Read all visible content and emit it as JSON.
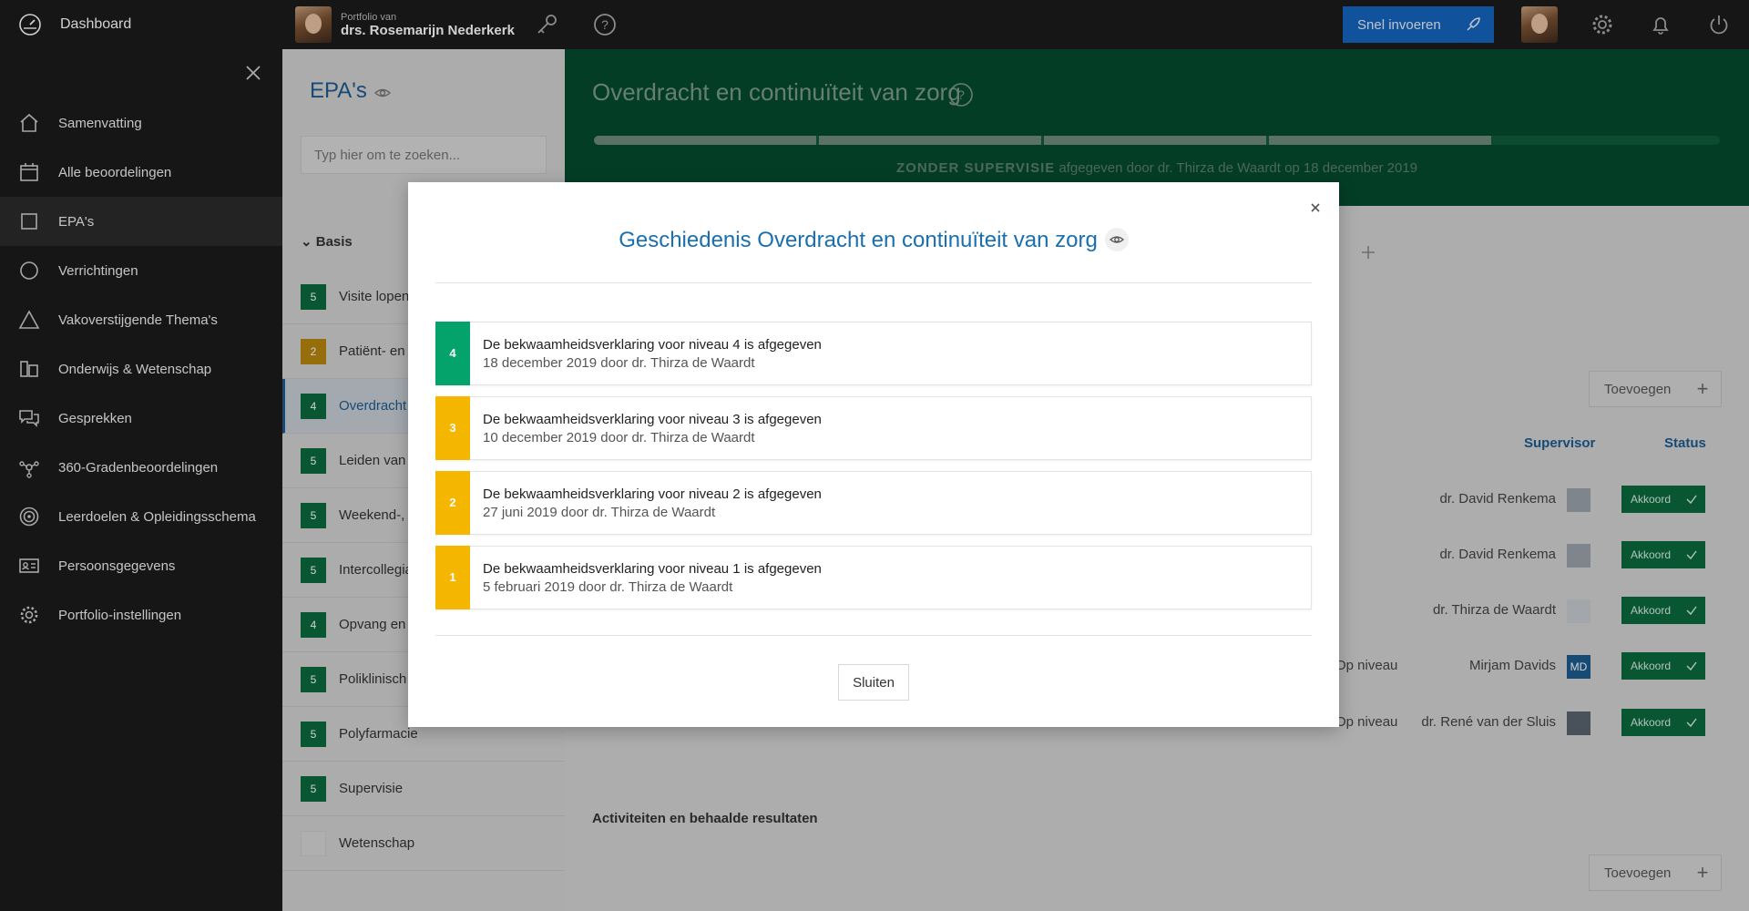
{
  "topbar": {
    "dashboard_label": "Dashboard",
    "portfolio_small": "Portfolio van",
    "portfolio_name": "drs. Rosemarijn Nederkerk",
    "snel_label": "Snel invoeren",
    "accent": "#1565c0"
  },
  "sidebar": {
    "items": [
      {
        "label": "Samenvatting",
        "icon": "home-icon"
      },
      {
        "label": "Alle beoordelingen",
        "icon": "calendar-icon"
      },
      {
        "label": "EPA's",
        "icon": "square-icon"
      },
      {
        "label": "Verrichtingen",
        "icon": "circle-icon"
      },
      {
        "label": "Vakoverstijgende Thema's",
        "icon": "triangle-icon"
      },
      {
        "label": "Onderwijs & Wetenschap",
        "icon": "books-icon"
      },
      {
        "label": "Gesprekken",
        "icon": "chat-icon"
      },
      {
        "label": "360-Gradenbeoordelingen",
        "icon": "network-icon"
      },
      {
        "label": "Leerdoelen & Opleidingsschema",
        "icon": "target-icon"
      },
      {
        "label": "Persoonsgegevens",
        "icon": "id-card-icon"
      },
      {
        "label": "Portfolio-instellingen",
        "icon": "gear-icon"
      }
    ]
  },
  "epa_panel": {
    "title": "EPA's",
    "search_placeholder": "Typ hier om te zoeken...",
    "group": "Basis",
    "items": [
      {
        "badge": "5",
        "label": "Visite lopen",
        "color": "#0b6a3f"
      },
      {
        "badge": "2",
        "label": "Patiënt- en f",
        "color": "#b8870e"
      },
      {
        "badge": "4",
        "label": "Overdracht",
        "color": "#0b6a3f"
      },
      {
        "badge": "5",
        "label": "Leiden van c",
        "color": "#0b6a3f"
      },
      {
        "badge": "5",
        "label": "Weekend-, a",
        "color": "#0b6a3f"
      },
      {
        "badge": "5",
        "label": "Intercollegia",
        "color": "#0b6a3f"
      },
      {
        "badge": "4",
        "label": "Opvang en b",
        "color": "#0b6a3f"
      },
      {
        "badge": "5",
        "label": "Poliklinisch",
        "color": "#0b6a3f"
      },
      {
        "badge": "5",
        "label": "Polyfarmacie",
        "color": "#0b6a3f"
      },
      {
        "badge": "5",
        "label": "Supervisie",
        "color": "#0b6a3f"
      },
      {
        "badge": "",
        "label": "Wetenschap",
        "color": "#d2d2d2"
      }
    ]
  },
  "main": {
    "title": "Overdracht en continuïteit van zorg",
    "progress_steps": 4,
    "progress_total": 5,
    "status_strong": "ZONDER SUPERVISIE",
    "status_rest": " afgegeven door dr. Thirza de Waardt op 18 december 2019",
    "add_label": "Toevoegen",
    "col_supervisor": "Supervisor",
    "col_status": "Status",
    "rows": [
      {
        "niveau": "",
        "supervisor": "dr. David Renkema",
        "avatar": "",
        "status": "Akkoord"
      },
      {
        "niveau": "",
        "supervisor": "dr. David Renkema",
        "avatar": "",
        "status": "Akkoord"
      },
      {
        "niveau": "",
        "supervisor": "dr. Thirza de Waardt",
        "avatar": "",
        "status": "Akkoord"
      },
      {
        "niveau": "Op niveau",
        "supervisor": "Mirjam Davids",
        "avatar": "MD",
        "status": "Akkoord"
      },
      {
        "niveau": "Op niveau",
        "supervisor": "dr. René van der Sluis",
        "avatar": "",
        "status": "Akkoord"
      }
    ],
    "activities_heading": "Activiteiten en behaalde resultaten"
  },
  "modal": {
    "title": "Geschiedenis Overdracht en continuïteit van zorg",
    "close_label": "Sluiten",
    "entries": [
      {
        "level": "4",
        "color": "#05a36c",
        "line1": "De bekwaamheidsverklaring voor niveau 4 is afgegeven",
        "line2": "18 december 2019 door dr. Thirza de Waardt"
      },
      {
        "level": "3",
        "color": "#f5b600",
        "line1": "De bekwaamheidsverklaring voor niveau 3 is afgegeven",
        "line2": "10 december 2019 door dr. Thirza de Waardt"
      },
      {
        "level": "2",
        "color": "#f5b600",
        "line1": "De bekwaamheidsverklaring voor niveau 2 is afgegeven",
        "line2": "27 juni 2019 door dr. Thirza de Waardt"
      },
      {
        "level": "1",
        "color": "#f5b600",
        "line1": "De bekwaamheidsverklaring voor niveau 1 is afgegeven",
        "line2": "5 februari 2019 door dr. Thirza de Waardt"
      }
    ]
  }
}
